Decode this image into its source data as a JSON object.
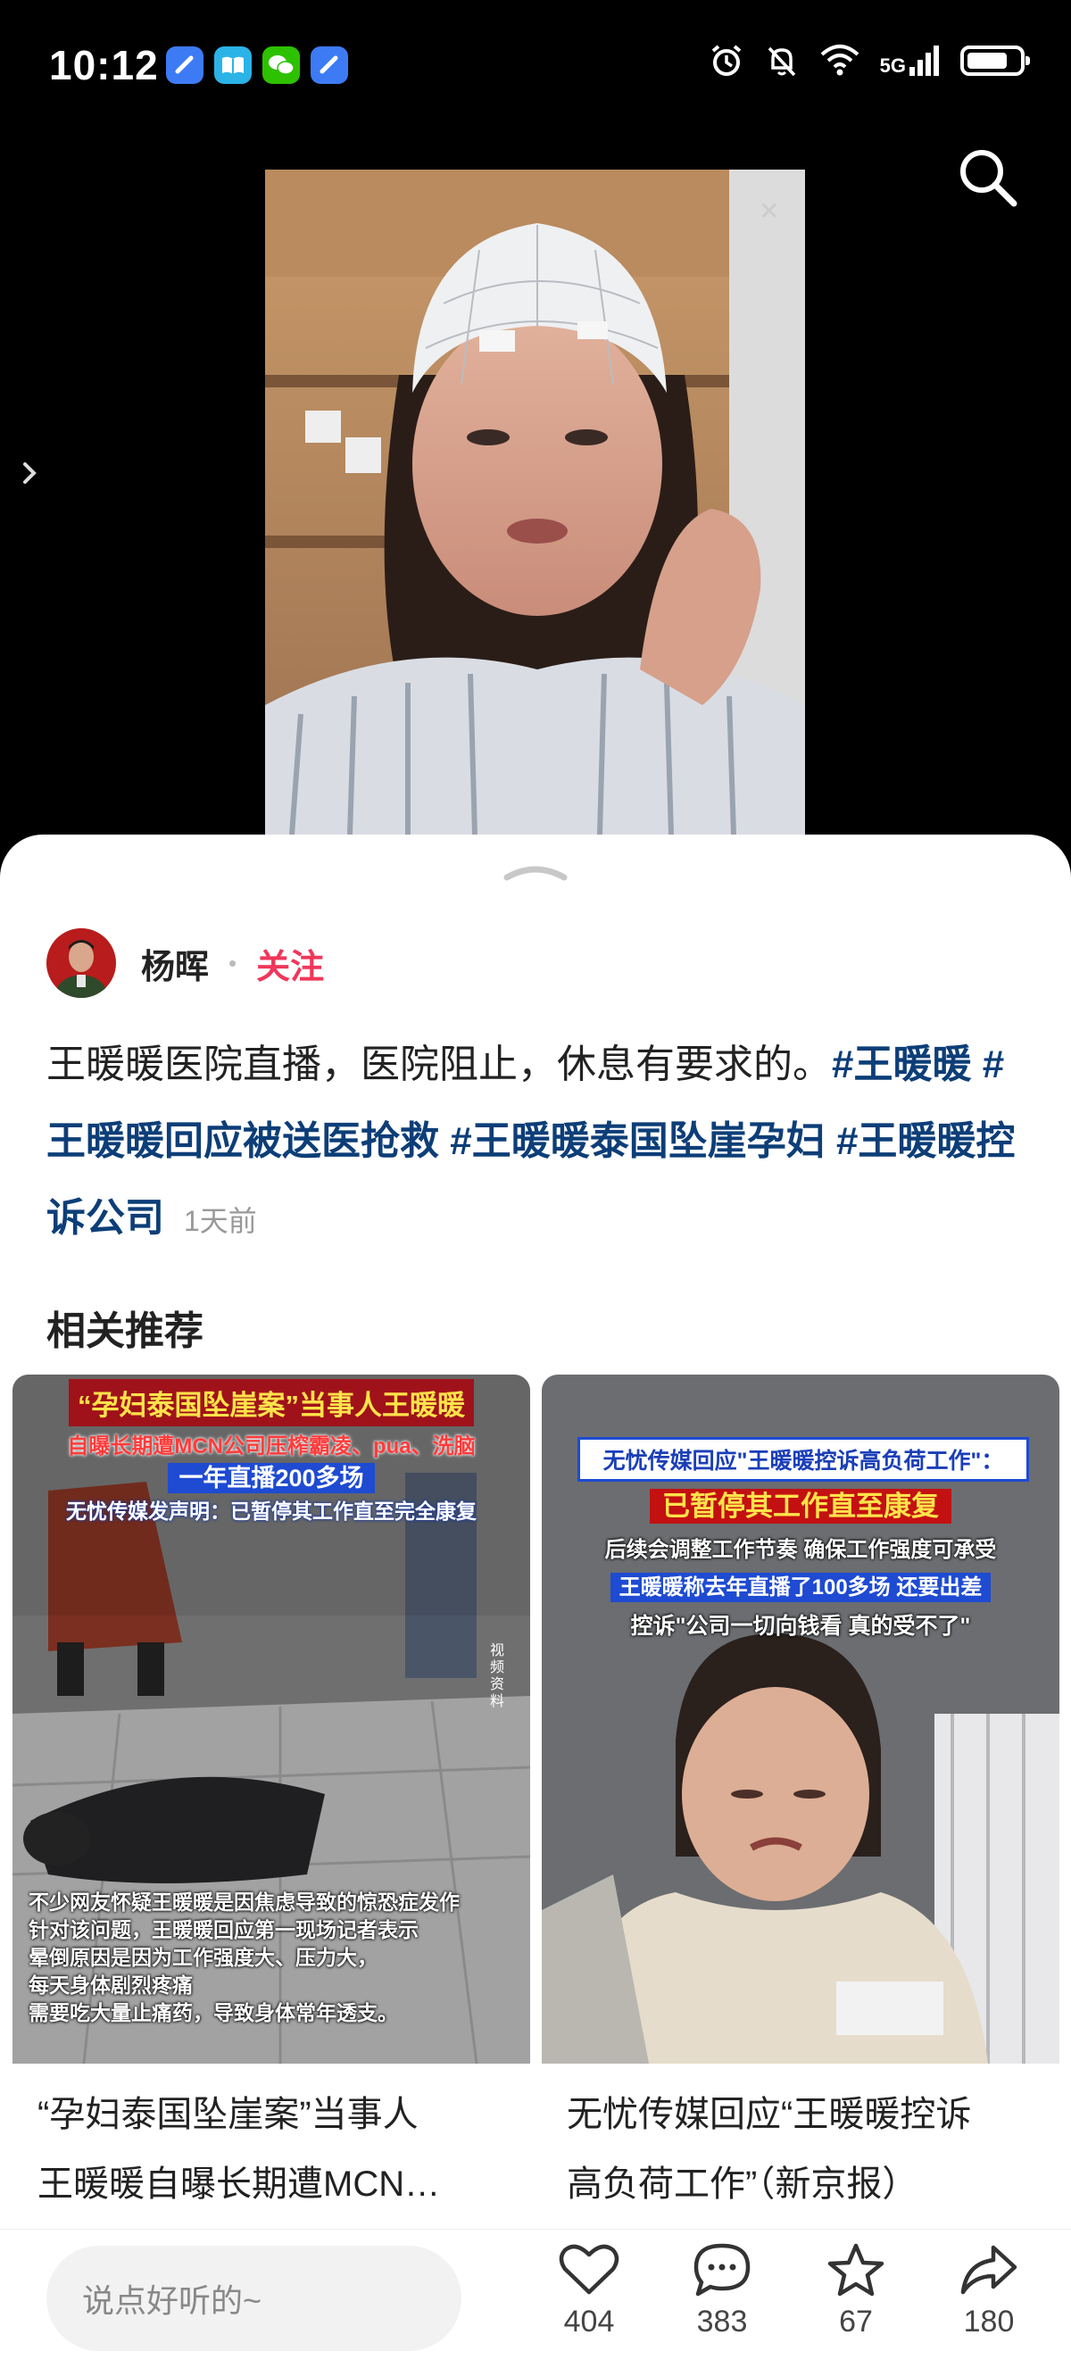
{
  "status_bar": {
    "time": "10:12",
    "network": "5G"
  },
  "author": {
    "name": "杨晖",
    "follow_label": "关注"
  },
  "post": {
    "text": "王暖暖医院直播，医院阻止，休息有要求的。",
    "tags": [
      "#王暖暖",
      "#王暖暖回应被送医抢救",
      "#王暖暖泰国坠崖孕妇",
      "#王暖暖控诉公司"
    ],
    "time_ago": "1天前"
  },
  "recommendations": {
    "title": "相关推荐",
    "items": [
      {
        "caption_line1": "“孕妇泰国坠崖案”当事人",
        "caption_line2": "王暖暖自曝长期遭MCN…",
        "overlay_title": "“孕妇泰国坠崖案”当事人王暖暖",
        "overlay_line2": "自曝长期遭MCN公司压榨霸凌、pua、洗脑",
        "overlay_line3": "一年直播200多场",
        "overlay_line4": "无忧传媒发声明：已暂停其工作直至完全康复",
        "overlay_side": "视频资料",
        "overlay_bottom": [
          "不少网友怀疑王暖暖是因焦虑导致的惊恐症发作",
          "针对该问题，王暖暖回应第一现场记者表示",
          "晕倒原因是因为工作强度大、压力大，",
          "每天身体剧烈疼痛",
          "需要吃大量止痛药，导致身体常年透支。"
        ]
      },
      {
        "caption_line1": "无忧传媒回应“王暖暖控诉",
        "caption_line2": "高负荷工作”（新京报）",
        "overlay_title": "无忧传媒回应\"王暖暖控诉高负荷工作\"：",
        "overlay_line2": "已暂停其工作直至康复",
        "overlay_line3": "后续会调整工作节奏 确保工作强度可承受",
        "overlay_line4": "王暖暖称去年直播了100多场 还要出差",
        "overlay_line5": "控诉\"公司一切向钱看 真的受不了\""
      }
    ]
  },
  "bottom_bar": {
    "comment_placeholder": "说点好听的~",
    "like_count": "404",
    "comment_count": "383",
    "favorite_count": "67",
    "share_count": "180"
  },
  "colors": {
    "accent_follow": "#f0365a",
    "tag": "#0d3e78"
  }
}
